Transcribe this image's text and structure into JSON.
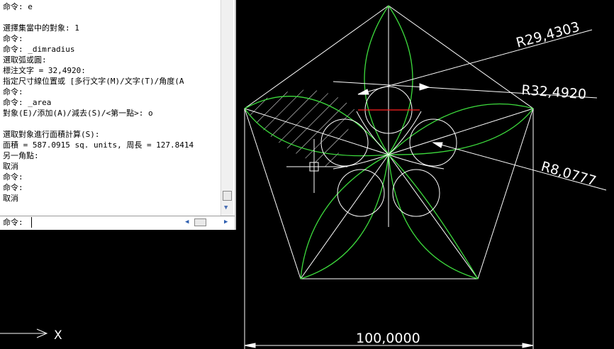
{
  "command_history": [
    "命令: e",
    "",
    "選擇集當中的對象: 1",
    "命令:",
    "命令: _dimradius",
    "選取弧或圓:",
    "標注文字 = 32,4920:",
    "指定尺寸線位置或 [多行文字(M)/文字(T)/角度(A",
    "命令:",
    "命令: _area",
    "對象(E)/添加(A)/減去(S)/<第一點>: o",
    "",
    "選取對象進行面積計算(S):",
    "面積 = 587.0915 sq. units, 周長 = 127.8414",
    "另一角點:",
    "取消",
    "命令:",
    "命令:",
    "取消"
  ],
  "command_prompt": "命令:",
  "command_input_value": "",
  "dimensions": {
    "radius_outer_arc": "R29,4303",
    "radius_arc": "R32,4920",
    "radius_circle": "R8,0777",
    "base_length": "100,0000"
  },
  "ucs_axis_label": "X",
  "colors": {
    "background": "#000000",
    "geometry": "#ffffff",
    "highlight_arc": "#3ddc3d",
    "highlight_line": "#ff2020"
  }
}
